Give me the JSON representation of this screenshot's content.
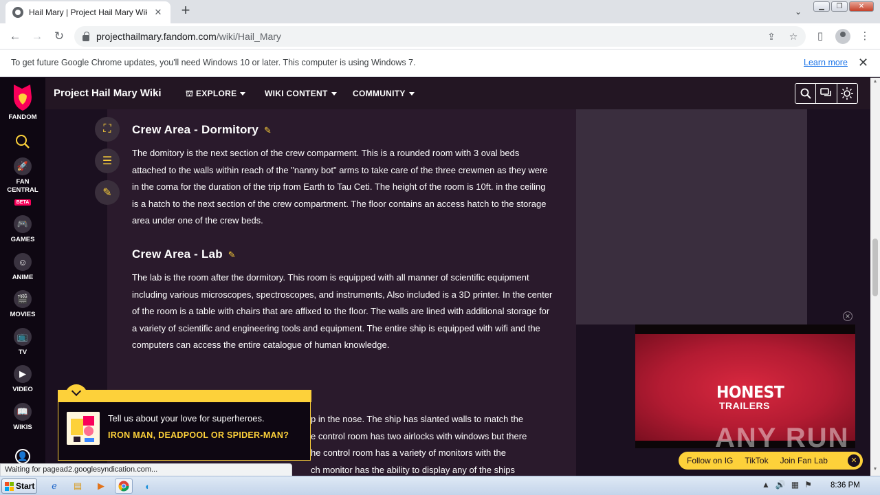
{
  "browser": {
    "tab_title": "Hail Mary | Project Hail Mary Wiki | F",
    "url_host": "projecthailmary.fandom.com",
    "url_path": "/wiki/Hail_Mary"
  },
  "infobar": {
    "message": "To get future Google Chrome updates, you'll need Windows 10 or later. This computer is using Windows 7.",
    "learn_more": "Learn more"
  },
  "rail": {
    "logo_label": "FANDOM",
    "fan_central": "FAN CENTRAL",
    "beta": "BETA",
    "games": "GAMES",
    "anime": "ANIME",
    "movies": "MOVIES",
    "tv": "TV",
    "video": "VIDEO",
    "wikis": "WIKIS"
  },
  "wiki": {
    "title": "Project Hail Mary Wiki",
    "explore": "EXPLORE",
    "wiki_content": "WIKI CONTENT",
    "community": "COMMUNITY"
  },
  "article": {
    "dormitory_heading": "Crew Area - Dormitory",
    "dormitory_text": "The domitory is the next section of the crew comparment. This is a rounded room with 3 oval beds attached to the walls within reach of the \"nanny bot\" arms to take care of the three crewmen as they were in the coma for the duration of the trip from Earth to Tau Ceti. The height of the room is 10ft. in the ceiling is a hatch to the next section of the crew compartment. The floor contains an access hatch to the storage area under one of the crew beds.",
    "lab_heading": "Crew Area - Lab",
    "lab_text": "The lab is the room after the dormitory. This room is equipped with all manner of scientific equipment including various microscopes, spectroscopes, and instruments, Also included is a 3D printer. In the center of the room is a table with chairs that are affixed to the floor. The walls are lined with additional storage for a variety of scientific and engineering tools and equipment. The entire ship is equipped with wifi and the computers can access the entire catalogue of human knowledge.",
    "partial_line_1": "p in the nose. The ship has slanted walls to match the",
    "partial_line_2": "e control room has two airlocks with windows but there",
    "partial_line_3": "he control room has a variety of monitors with the",
    "partial_line_4": "ch monitor has the ability to display any of the ships"
  },
  "quiz": {
    "question": "Tell us about your love for superheroes.",
    "answer": "IRON MAN, DEADPOOL OR SPIDER-MAN?"
  },
  "status_text": "Waiting for pagead2.googlesyndication.com...",
  "ad": {
    "line1": "HONEST",
    "line2": "TRAILERS",
    "watermark": "ANY RUN"
  },
  "social": {
    "instagram": "Follow on IG",
    "tiktok": "TikTok",
    "fan_lab": "Join Fan Lab"
  },
  "taskbar": {
    "start": "Start",
    "clock": "8:36 PM"
  },
  "colors": {
    "fandom_yellow": "#fdd13a",
    "page_bg": "#1b1020",
    "content_bg": "#2a1a2c",
    "fandom_pink": "#fa005a"
  }
}
